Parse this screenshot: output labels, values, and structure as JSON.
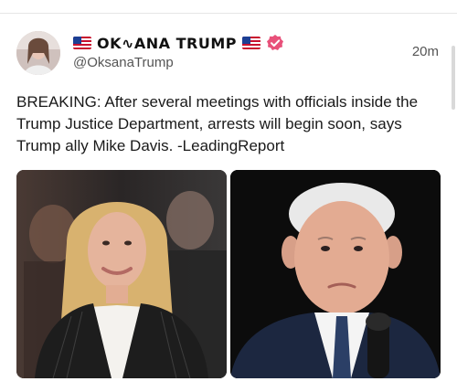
{
  "post": {
    "display_name": "OK∿ANA TRUMP",
    "handle": "@OksanaTrump",
    "timestamp": "20m",
    "text": "BREAKING: After several meetings with officials inside the Trump Justice Department, arrests will begin soon, says Trump ally Mike Davis. -LeadingReport"
  },
  "icons": {
    "flag": "us-flag-icon",
    "verified": "verified-badge-icon"
  },
  "colors": {
    "verified_badge": "#e8517a",
    "text": "#1a1a1a",
    "muted": "#555555"
  }
}
